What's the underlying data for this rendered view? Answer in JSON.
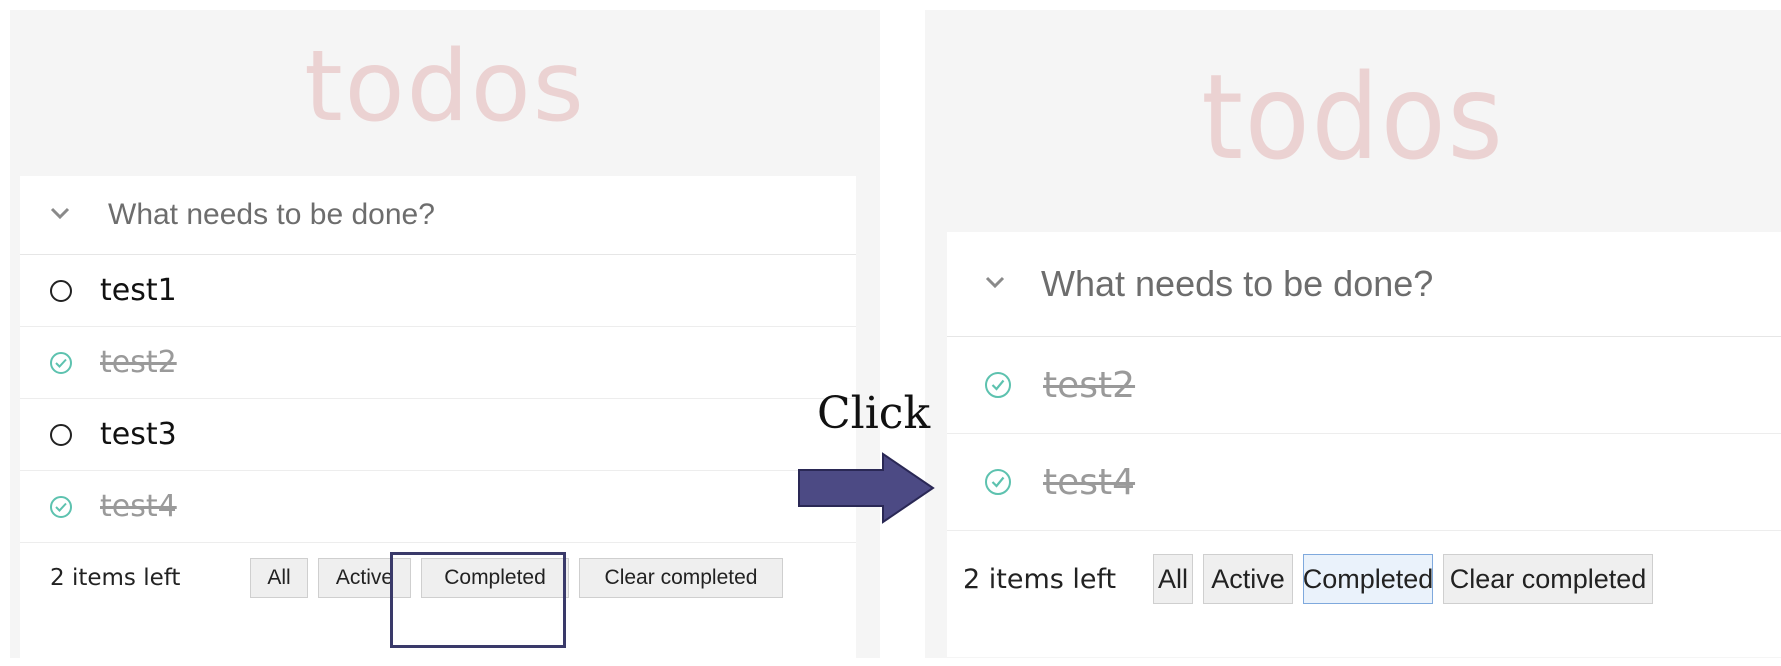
{
  "before": {
    "title": "todos",
    "input": {
      "placeholder": "What needs to be done?",
      "value": ""
    },
    "items": [
      {
        "text": "test1",
        "completed": false
      },
      {
        "text": "test2",
        "completed": true
      },
      {
        "text": "test3",
        "completed": false
      },
      {
        "text": "test4",
        "completed": true
      }
    ],
    "count_label": "2 items left",
    "filters": [
      "All",
      "Active",
      "Completed",
      "Clear completed"
    ],
    "selected_filter": "All"
  },
  "after": {
    "title": "todos",
    "input": {
      "placeholder": "What needs to be done?",
      "value": ""
    },
    "items": [
      {
        "text": "test2",
        "completed": true
      },
      {
        "text": "test4",
        "completed": true
      }
    ],
    "count_label": "2 items left",
    "filters": [
      "All",
      "Active",
      "Completed",
      "Clear completed"
    ],
    "selected_filter": "Completed"
  },
  "annotation": {
    "label": "Click",
    "highlight_target": "Completed",
    "arrow_color": "#4c4a84",
    "arrow_border": "#2a2855"
  },
  "colors": {
    "title": "#ebd2d2",
    "panel_bg": "#f5f5f5",
    "check_done": "#5dc2af",
    "completed_text": "#9a9a9a",
    "selected_button_border": "#7fa9dd"
  },
  "icons": {
    "toggle_all": "chevron-down-icon",
    "open_item": "circle-icon",
    "done_item": "check-circle-icon"
  }
}
